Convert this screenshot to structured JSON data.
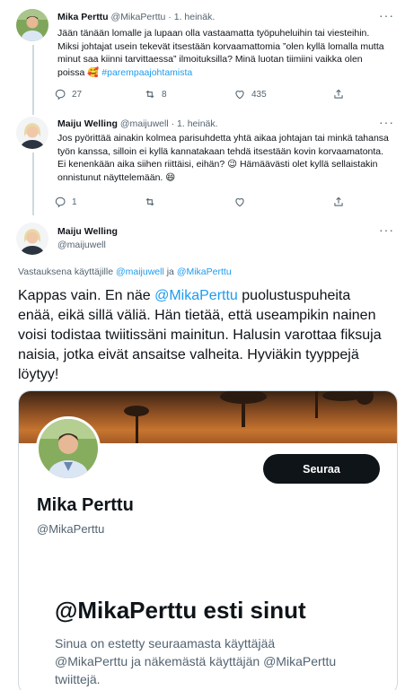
{
  "tweets": [
    {
      "name": "Mika Perttu",
      "handle": "@MikaPerttu",
      "date": "1. heinäk.",
      "text_before": "Jään tänään lomalle ja lupaan olla vastaamatta työpuheluihin tai viesteihin. Miksi johtajat usein tekevät itsestään korvaamattomia ”olen kyllä lomalla mutta minut saa kiinni tarvittaessa” ilmoituksilla? Minä luotan tiimiini vaikka olen poissa 🥰 ",
      "hashtag": "#parempaajohtamista",
      "replies": "27",
      "retweets": "8",
      "likes": "435"
    },
    {
      "name": "Maiju Welling",
      "handle": "@maijuwell",
      "date": "1. heinäk.",
      "text": "Jos pyörittää ainakin kolmea parisuhdetta yhtä aikaa johtajan tai minkä tahansa työn kanssa, silloin ei kyllä kannatakaan tehdä itsestään kovin korvaamatonta. Ei kenenkään aika siihen riittäisi, eihän? 😉 Hämäävästi olet kyllä sellaistakin onnistunut näyttelemään. 😄",
      "replies": "1",
      "retweets": "",
      "likes": ""
    }
  ],
  "main_tweet": {
    "name": "Maiju Welling",
    "handle": "@maijuwell",
    "reply_prefix": "Vastauksena käyttäjille ",
    "reply_handle1": "@maijuwell",
    "reply_and": " ja ",
    "reply_handle2": "@MikaPerttu",
    "text_start": "Kappas vain. En näe ",
    "text_mention": "@MikaPerttu",
    "text_rest": " puolustuspuheita enää, eikä sillä väliä. Hän tietää, että useampikin nainen voisi todistaa twiitissäni mainitun. Halusin varottaa fiksuja naisia, jotka eivät ansaitse valheita. Hyviäkin tyyppejä löytyy!"
  },
  "embedded_card": {
    "follow_label": "Seuraa",
    "name": "Mika Perttu",
    "handle": "@MikaPerttu",
    "blocked_title": "@MikaPerttu esti sinut",
    "blocked_desc": "Sinua on estetty seuraamasta käyttäjää @MikaPerttu ja näkemästä käyttäjän @MikaPerttu twiittejä."
  },
  "colors": {
    "link": "#1d9bf0",
    "muted": "#536471",
    "text": "#0f1419",
    "button": "#0f1419"
  }
}
